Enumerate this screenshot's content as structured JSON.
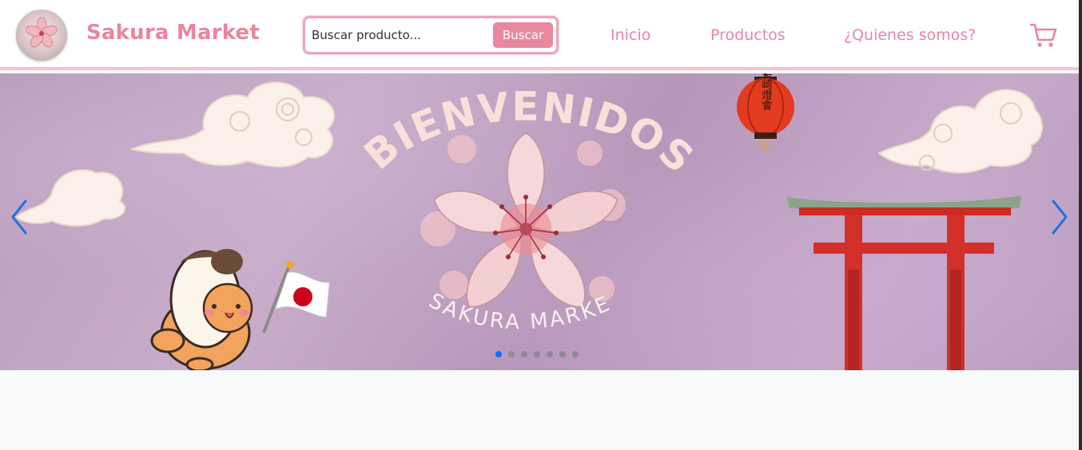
{
  "header": {
    "brand": "Sakura Market",
    "search": {
      "placeholder": "Buscar producto...",
      "value": "",
      "button_label": "Buscar"
    },
    "nav": [
      {
        "label": "Inicio"
      },
      {
        "label": "Productos"
      },
      {
        "label": "¿Quienes somos?"
      }
    ],
    "cart_icon": "shopping-cart-icon"
  },
  "carousel": {
    "banner": {
      "headline": "BIENVENIDOS",
      "subline": "SAKURA MARKET",
      "lantern_text": "長崎燈會"
    },
    "slide_count": 7,
    "active_slide": 1,
    "prev_icon": "chevron-left-icon",
    "next_icon": "chevron-right-icon"
  },
  "colors": {
    "accent_pink": "#e8869d",
    "indicator_active": "#0d6efd",
    "banner_purple": "#c2a6c6"
  }
}
